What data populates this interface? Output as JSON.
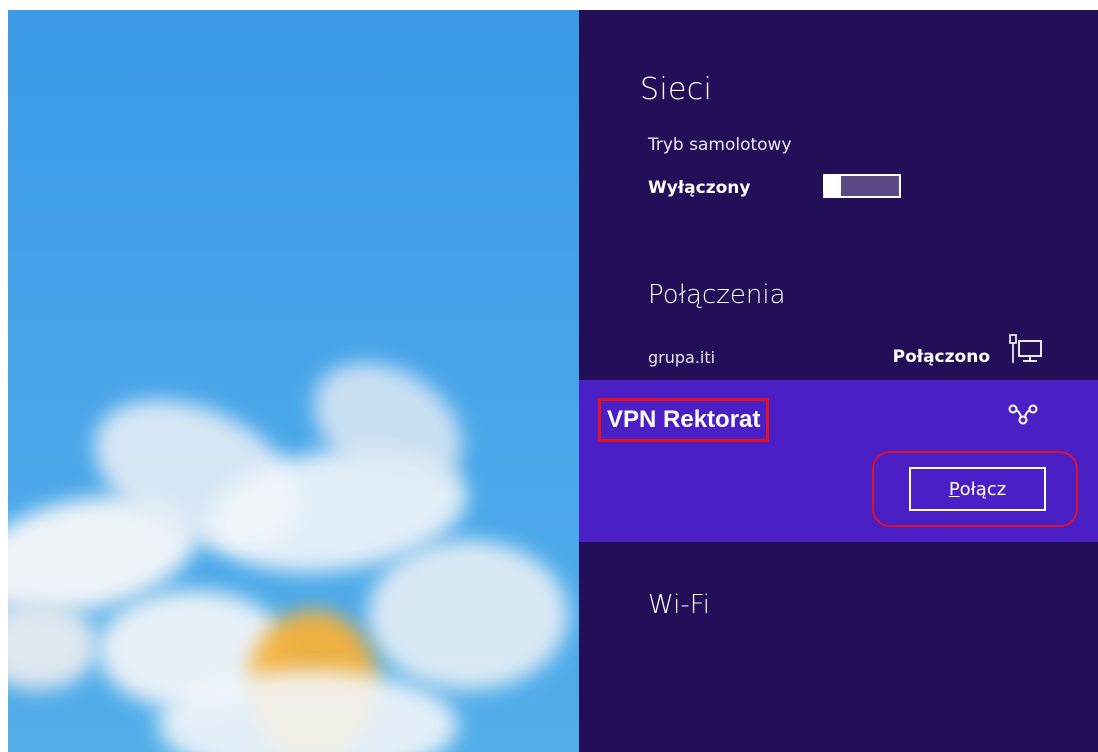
{
  "panel": {
    "title": "Sieci",
    "airplane_mode": {
      "label": "Tryb samolotowy",
      "state": "Wyłączony",
      "on": false
    },
    "connections": {
      "title": "Połączenia",
      "items": [
        {
          "name": "grupa.iti",
          "status": "Połączono",
          "icon": "wired-network-icon"
        }
      ]
    },
    "vpn": {
      "name": "VPN Rektorat",
      "icon": "vpn-icon",
      "connect_first": "P",
      "connect_rest": "ołącz"
    },
    "wifi": {
      "title": "Wi-Fi"
    }
  },
  "colors": {
    "panel_bg": "#230f58",
    "vpn_row_bg": "#4a1fc6",
    "highlight": "#e8101f",
    "desktop_sky": "#46a3ea"
  }
}
